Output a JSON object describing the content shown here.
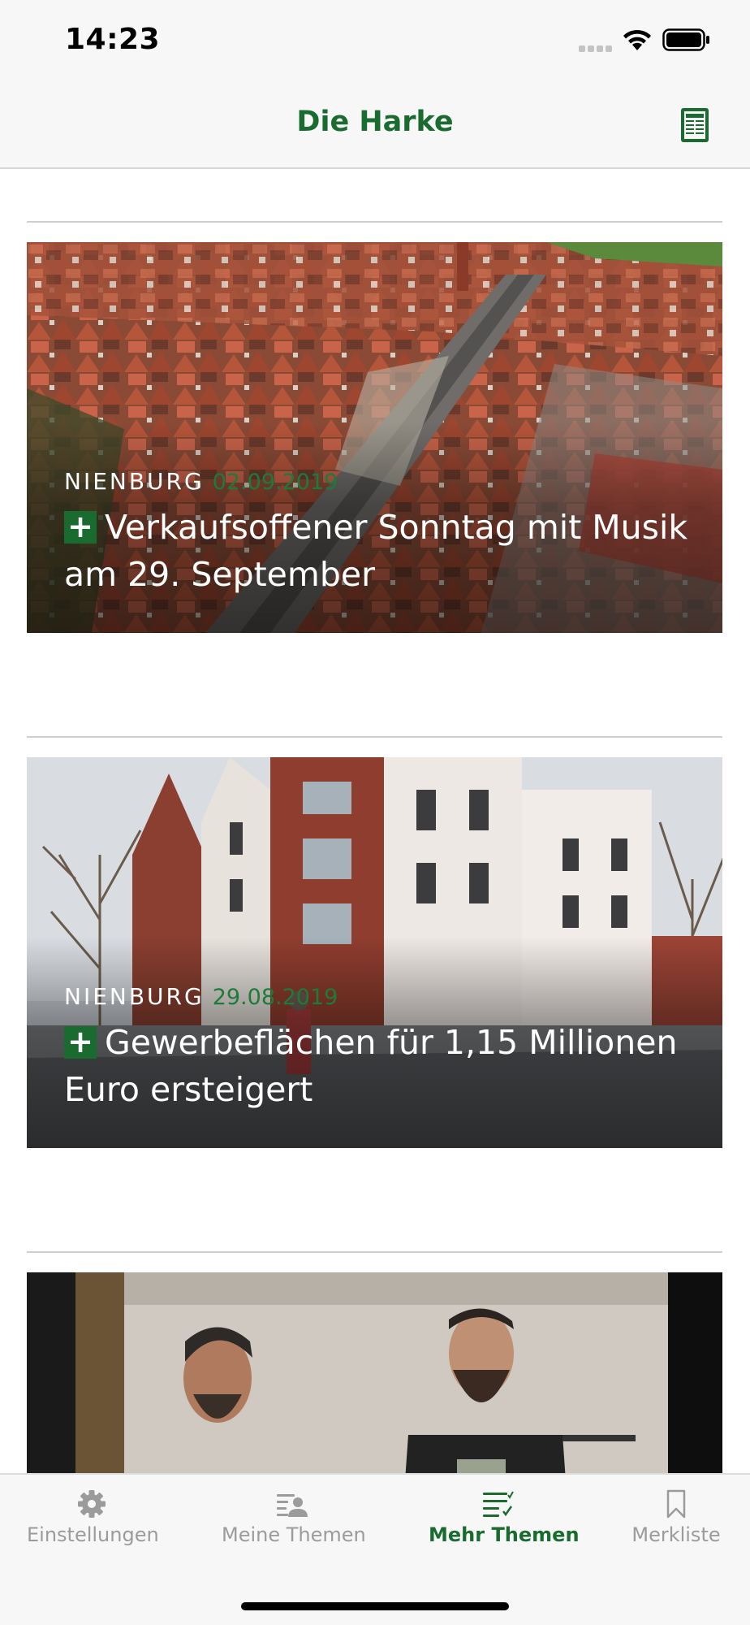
{
  "status_bar": {
    "time": "14:23"
  },
  "header": {
    "title": "Die Harke",
    "epaper_icon": "newspaper-icon"
  },
  "articles": [
    {
      "section": "NIENBURG",
      "date": "02.09.2019",
      "premium_badge": "+",
      "title": "Verkaufsoffener Sonntag mit Musik am 29. September",
      "image": "aerial view of town rooftops and main street"
    },
    {
      "section": "NIENBURG",
      "date": "29.08.2019",
      "premium_badge": "+",
      "title": "Gewerbeflächen für 1,15 Millionen Euro ersteigert",
      "image": "brick commercial buildings on a pedestrian street"
    },
    {
      "image": "two bearded men laughing in a hallway"
    }
  ],
  "tab_bar": {
    "tabs": [
      {
        "label": "Einstellungen",
        "icon": "gear-icon",
        "active": false
      },
      {
        "label": "Meine Themen",
        "icon": "user-list-icon",
        "active": false
      },
      {
        "label": "Mehr Themen",
        "icon": "checklist-icon",
        "active": true
      },
      {
        "label": "Merkliste",
        "icon": "bookmark-icon",
        "active": false
      }
    ]
  },
  "colors": {
    "brand_green": "#1a6b2f",
    "tab_inactive": "#9b9b9b",
    "bar_background": "#f7f7f7"
  }
}
